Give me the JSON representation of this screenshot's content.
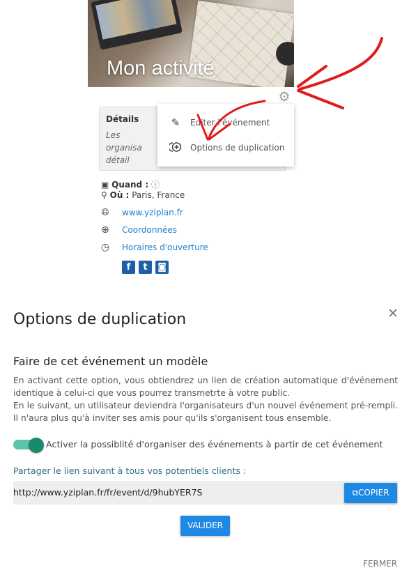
{
  "card": {
    "title": "Mon activité",
    "details_heading": "Détails",
    "details_text": "Les organisa\ndétail",
    "when_label": "Quand :",
    "where_label": "Où :",
    "where_value": "Paris, France",
    "website": "www.yziplan.fr",
    "contact_link": "Coordonnées",
    "hours_link": "Horaires d'ouverture"
  },
  "menu": {
    "items": [
      {
        "label": "Editer l'événement",
        "icon": "pencil-icon"
      },
      {
        "label": "Options de duplication",
        "icon": "duplicate-icon"
      }
    ]
  },
  "dialog": {
    "title": "Options de duplication",
    "subtitle": "Faire de cet événement un modèle",
    "paragraph1": "En activant cette option, vous obtiendrez un lien de création automatique d'événement identique à celui-ci que vous pourrez transmetrte à votre public.",
    "paragraph2": "En le suivant, un utilisateur deviendra l'organisateurs d'un nouvel événement pré-rempli. Il n'aura plus qu'à inviter ses amis pour qu'ils s'organisent tous ensemble.",
    "toggle_label": "Activer la possiblité d'organiser des événements à partir de cet événement",
    "toggle_on": true,
    "share_label": "Partager le lien suivant à tous vos potentiels clients :",
    "share_url": "http://www.yziplan.fr/fr/event/d/9hubYER7S",
    "copy_label": "COPIER",
    "validate_label": "VALIDER",
    "close_label": "FERMER"
  },
  "colors": {
    "accent": "#1e88e5",
    "toggle": "#1a8a6c",
    "annotation_arrow": "#e01b1b"
  }
}
